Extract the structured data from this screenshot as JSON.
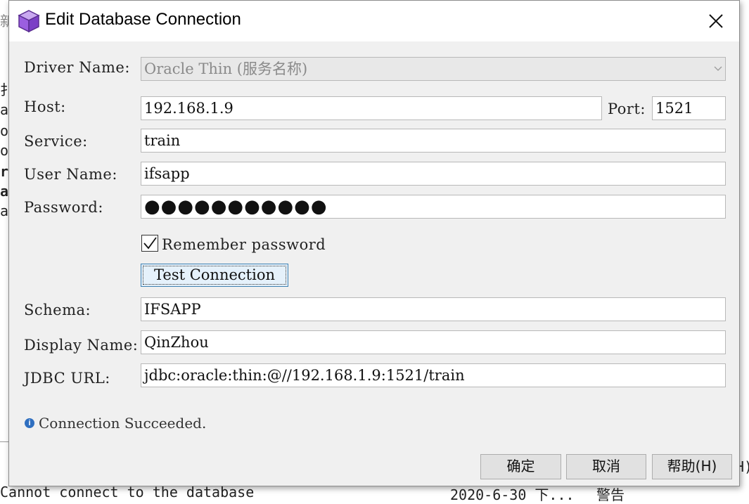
{
  "background": {
    "fragments": [
      "新",
      "扌",
      "am",
      "oc",
      "oc",
      "ra",
      "at",
      "ar",
      "Cannot connect to the database",
      "2020-6-30 下...",
      "警告",
      "H)"
    ]
  },
  "dialog": {
    "title": "Edit Database Connection",
    "labels": {
      "driver_name": "Driver Name:",
      "host": "Host:",
      "port": "Port:",
      "service": "Service:",
      "user_name": "User Name:",
      "password": "Password:",
      "schema": "Schema:",
      "display_name": "Display Name:",
      "jdbc_url": "JDBC URL:"
    },
    "values": {
      "driver_name": "Oracle Thin (服务名称)",
      "host": "192.168.1.9",
      "port": "1521",
      "service": "train",
      "user_name": "ifsapp",
      "password_mask": "●●●●●●●●●●●",
      "schema": "IFSAPP",
      "display_name": "QinZhou",
      "jdbc_url": "jdbc:oracle:thin:@//192.168.1.9:1521/train"
    },
    "remember_password": {
      "label": "Remember password",
      "checked": true
    },
    "test_connection_label": "Test Connection",
    "status_text": "Connection Succeeded.",
    "buttons": {
      "ok": "确定",
      "cancel": "取消",
      "help": "帮助(H)"
    }
  }
}
